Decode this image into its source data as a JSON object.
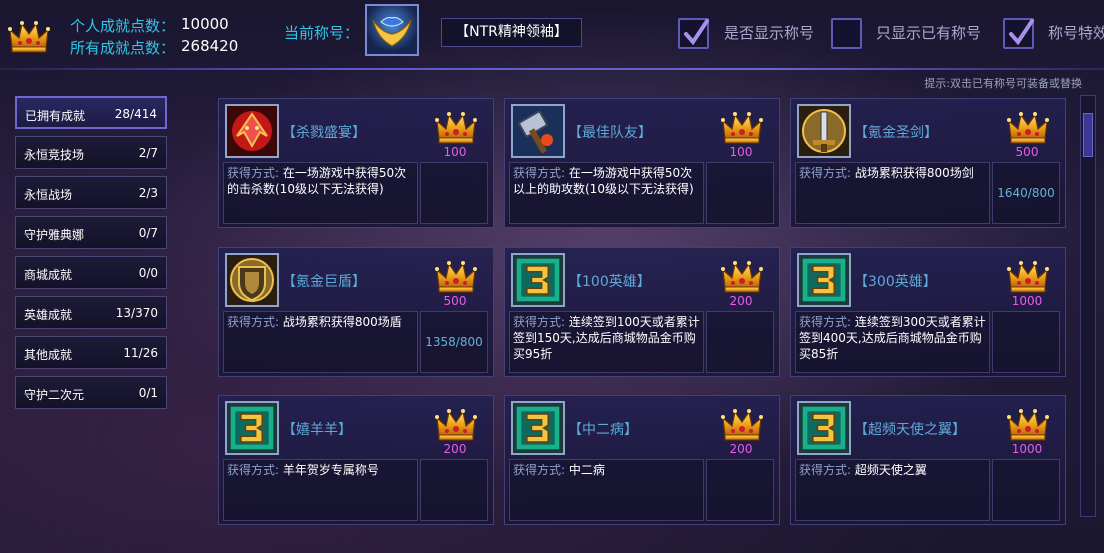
{
  "header": {
    "personal_points_label": "个人成就点数：",
    "personal_points_value": "10000",
    "all_points_label": "所有成就点数：",
    "all_points_value": "268420",
    "current_title_label": "当前称号：",
    "current_title_name": "【NTR精神领袖】",
    "options": [
      {
        "label": "是否显示称号",
        "checked": true
      },
      {
        "label": "只显示已有称号",
        "checked": false
      },
      {
        "label": "称号特效",
        "checked": true
      }
    ],
    "hint": "提示:双击已有称号可装备或替换"
  },
  "sidebar": {
    "items": [
      {
        "name": "已拥有成就",
        "count": "28/414",
        "active": true
      },
      {
        "name": "永恒竞技场",
        "count": "2/7",
        "active": false
      },
      {
        "name": "永恒战场",
        "count": "2/3",
        "active": false
      },
      {
        "name": "守护雅典娜",
        "count": "0/7",
        "active": false
      },
      {
        "name": "商城成就",
        "count": "0/0",
        "active": false
      },
      {
        "name": "英雄成就",
        "count": "13/370",
        "active": false
      },
      {
        "name": "其他成就",
        "count": "11/26",
        "active": false
      },
      {
        "name": "守护二次元",
        "count": "0/1",
        "active": false
      }
    ]
  },
  "cards": [
    {
      "title": "【杀戮盛宴】",
      "points": "100",
      "how_label": "获得方式:",
      "desc": "在一场游戏中获得50次的击杀数(10级以下无法获得)",
      "progress": "",
      "icon": "red-dragon-icon"
    },
    {
      "title": "【最佳队友】",
      "points": "100",
      "how_label": "获得方式:",
      "desc": "在一场游戏中获得50次以上的助攻数(10级以下无法获得)",
      "progress": "",
      "icon": "hammer-icon"
    },
    {
      "title": "【氪金圣剑】",
      "points": "500",
      "how_label": "获得方式:",
      "desc": "战场累积获得800场剑",
      "progress": "1640/800",
      "icon": "sword-icon"
    },
    {
      "title": "【氪金巨盾】",
      "points": "500",
      "how_label": "获得方式:",
      "desc": "战场累积获得800场盾",
      "progress": "1358/800",
      "icon": "shield-icon"
    },
    {
      "title": "【100英雄】",
      "points": "200",
      "how_label": "获得方式:",
      "desc": "连续签到100天或者累计签到150天,达成后商城物品金币购买95折",
      "progress": "",
      "icon": "emblem-3-icon"
    },
    {
      "title": "【300英雄】",
      "points": "1000",
      "how_label": "获得方式:",
      "desc": "连续签到300天或者累计签到400天,达成后商城物品金币购买85折",
      "progress": "",
      "icon": "emblem-3-icon"
    },
    {
      "title": "【嬉羊羊】",
      "points": "200",
      "how_label": "获得方式:",
      "desc": "羊年贺岁专属称号",
      "progress": "",
      "icon": "emblem-3-icon"
    },
    {
      "title": "【中二病】",
      "points": "200",
      "how_label": "获得方式:",
      "desc": "中二病",
      "progress": "",
      "icon": "emblem-3-icon"
    },
    {
      "title": "【超频天使之翼】",
      "points": "1000",
      "how_label": "获得方式:",
      "desc": "超频天使之翼",
      "progress": "",
      "icon": "emblem-3-icon"
    }
  ],
  "colors": {
    "accent_cyan": "#2fc6e8",
    "points_magenta": "#e85ce8",
    "frame_purple": "#5e5ab8"
  }
}
